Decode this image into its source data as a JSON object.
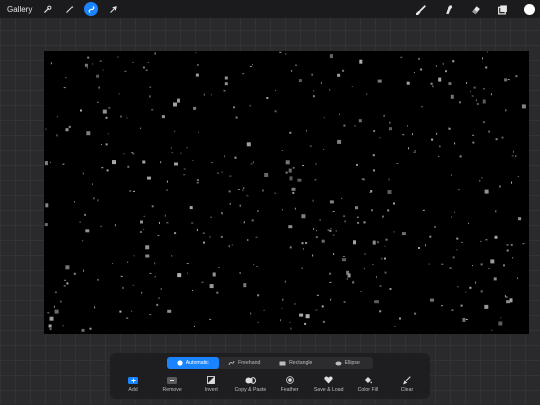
{
  "topbar": {
    "gallery_label": "Gallery",
    "left_tools": [
      "wrench-icon",
      "magic-wand-icon",
      "selection-icon",
      "arrow-cursor-icon"
    ],
    "active_tool": "selection-icon",
    "right_tools": [
      "brush-icon",
      "smudge-icon",
      "eraser-icon",
      "layers-icon"
    ],
    "current_color": "#ffffff"
  },
  "canvas": {
    "background": "#000000",
    "content": "scattered grey pixel specks"
  },
  "selection_toolbar": {
    "modes": [
      {
        "label": "Automatic",
        "icon": "automatic-icon",
        "active": true
      },
      {
        "label": "Freehand",
        "icon": "freehand-icon",
        "active": false
      },
      {
        "label": "Rectangle",
        "icon": "rectangle-icon",
        "active": false
      },
      {
        "label": "Ellipse",
        "icon": "ellipse-icon",
        "active": false
      }
    ],
    "actions": [
      {
        "label": "Add",
        "icon": "add-icon"
      },
      {
        "label": "Remove",
        "icon": "remove-icon"
      },
      {
        "label": "Invert",
        "icon": "invert-icon"
      },
      {
        "label": "Copy & Paste",
        "icon": "copy-paste-icon"
      },
      {
        "label": "Feather",
        "icon": "feather-icon"
      },
      {
        "label": "Save & Load",
        "icon": "save-load-icon"
      },
      {
        "label": "Color Fill",
        "icon": "color-fill-icon"
      },
      {
        "label": "Clear",
        "icon": "clear-icon"
      }
    ],
    "accent": "#1a84ff"
  }
}
